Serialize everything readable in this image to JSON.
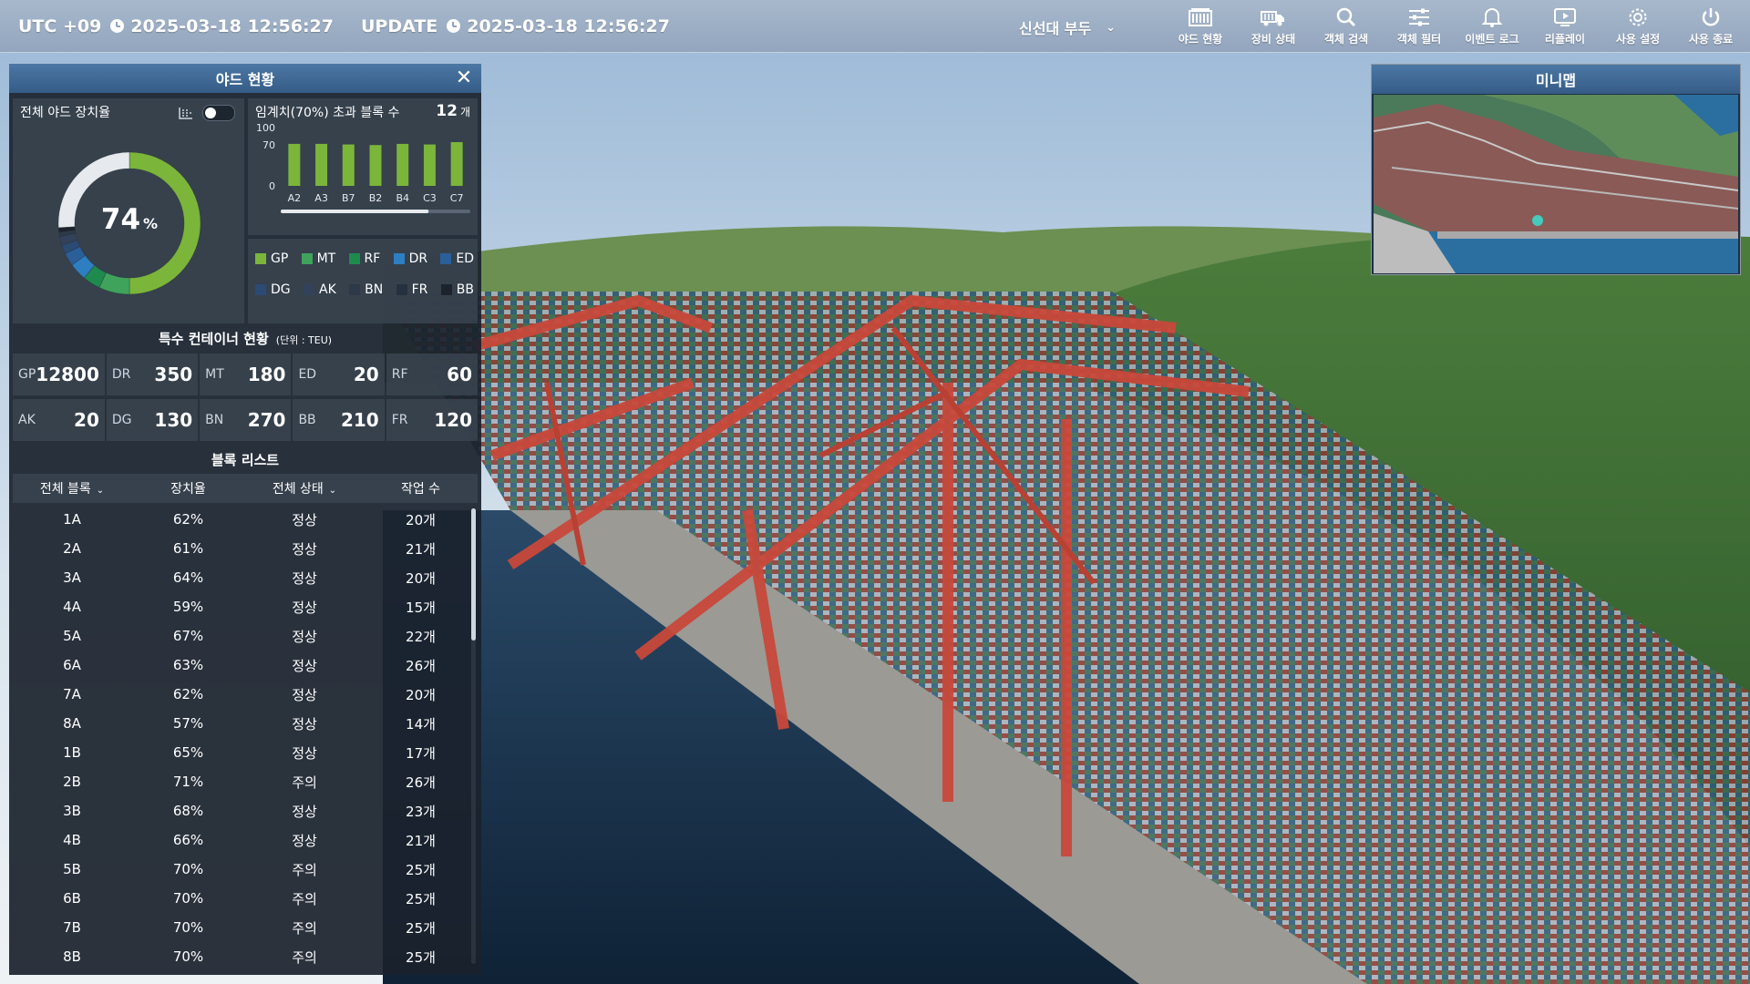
{
  "topbar": {
    "utc_label": "UTC +09",
    "utc_time": "2025-03-18 12:56:27",
    "update_label": "UPDATE",
    "update_time": "2025-03-18 12:56:27",
    "site": "신선대 부두",
    "menu": [
      {
        "label": "야드 현황",
        "icon": "yard-status-icon"
      },
      {
        "label": "장비 상태",
        "icon": "truck-icon"
      },
      {
        "label": "객체 검색",
        "icon": "search-icon"
      },
      {
        "label": "객체 필터",
        "icon": "filter-sliders-icon"
      },
      {
        "label": "이벤트 로그",
        "icon": "bell-icon"
      },
      {
        "label": "리플레이",
        "icon": "replay-icon"
      },
      {
        "label": "사용 설정",
        "icon": "gear-icon"
      },
      {
        "label": "사용 종료",
        "icon": "power-icon"
      }
    ]
  },
  "yard_panel": {
    "title": "야드 현황",
    "utilization_title": "전체 야드 장치율",
    "utilization_value": "74",
    "utilization_unit": "%",
    "threshold_title": "임계치(70%) 초과 블록 수",
    "threshold_count": "12",
    "threshold_unit": "개",
    "legend": [
      {
        "code": "GP",
        "color": "#7bb53a"
      },
      {
        "code": "MT",
        "color": "#3fa35c"
      },
      {
        "code": "RF",
        "color": "#1f8a4d"
      },
      {
        "code": "DR",
        "color": "#2d7fc1"
      },
      {
        "code": "ED",
        "color": "#2a5f9a"
      },
      {
        "code": "DG",
        "color": "#2b4a74"
      },
      {
        "code": "AK",
        "color": "#33425a"
      },
      {
        "code": "BN",
        "color": "#2d3848"
      },
      {
        "code": "FR",
        "color": "#263140"
      },
      {
        "code": "BB",
        "color": "#1c232d"
      }
    ],
    "special_title": "특수 컨테이너 현황",
    "special_unit": "(단위 : TEU)",
    "teu": [
      {
        "code": "GP",
        "value": "12800"
      },
      {
        "code": "DR",
        "value": "350"
      },
      {
        "code": "MT",
        "value": "180"
      },
      {
        "code": "ED",
        "value": "20"
      },
      {
        "code": "RF",
        "value": "60"
      },
      {
        "code": "AK",
        "value": "20"
      },
      {
        "code": "DG",
        "value": "130"
      },
      {
        "code": "BN",
        "value": "270"
      },
      {
        "code": "BB",
        "value": "210"
      },
      {
        "code": "FR",
        "value": "120"
      }
    ],
    "block_list_title": "블록 리스트",
    "columns": [
      "전체 블록",
      "장치율",
      "전체 상태",
      "작업 수"
    ],
    "rows": [
      [
        "1A",
        "62%",
        "정상",
        "20개"
      ],
      [
        "2A",
        "61%",
        "정상",
        "21개"
      ],
      [
        "3A",
        "64%",
        "정상",
        "20개"
      ],
      [
        "4A",
        "59%",
        "정상",
        "15개"
      ],
      [
        "5A",
        "67%",
        "정상",
        "22개"
      ],
      [
        "6A",
        "63%",
        "정상",
        "26개"
      ],
      [
        "7A",
        "62%",
        "정상",
        "20개"
      ],
      [
        "8A",
        "57%",
        "정상",
        "14개"
      ],
      [
        "1B",
        "65%",
        "정상",
        "17개"
      ],
      [
        "2B",
        "71%",
        "주의",
        "26개"
      ],
      [
        "3B",
        "68%",
        "정상",
        "23개"
      ],
      [
        "4B",
        "66%",
        "정상",
        "21개"
      ],
      [
        "5B",
        "70%",
        "주의",
        "25개"
      ],
      [
        "6B",
        "70%",
        "주의",
        "25개"
      ],
      [
        "7B",
        "70%",
        "주의",
        "25개"
      ],
      [
        "8B",
        "70%",
        "주의",
        "25개"
      ]
    ]
  },
  "chart_data": [
    {
      "type": "pie",
      "title": "전체 야드 장치율",
      "center_label": "74 %",
      "segments": [
        {
          "code": "GP",
          "value": 50,
          "color": "#7bb53a"
        },
        {
          "code": "MT",
          "value": 7,
          "color": "#3fa35c"
        },
        {
          "code": "RF",
          "value": 4,
          "color": "#1f8a4d"
        },
        {
          "code": "DR",
          "value": 4,
          "color": "#2d7fc1"
        },
        {
          "code": "ED",
          "value": 3,
          "color": "#2a5f9a"
        },
        {
          "code": "DG",
          "value": 2,
          "color": "#2b4a74"
        },
        {
          "code": "AK",
          "value": 2,
          "color": "#33425a"
        },
        {
          "code": "BN",
          "value": 1,
          "color": "#2d3848"
        },
        {
          "code": "BB",
          "value": 1,
          "color": "#1c232d"
        },
        {
          "code": "empty",
          "value": 26,
          "color": "#e6e9ee"
        }
      ]
    },
    {
      "type": "bar",
      "title": "임계치(70%) 초과 블록 수",
      "categories": [
        "A2",
        "A3",
        "B7",
        "B2",
        "B4",
        "C3",
        "C7"
      ],
      "values": [
        72,
        72,
        71,
        70,
        72,
        71,
        75
      ],
      "ylim": [
        0,
        100
      ],
      "yticks": [
        0,
        70,
        100
      ],
      "threshold": 70,
      "color": "#7bb53a"
    }
  ],
  "minimap": {
    "title": "미니맵"
  }
}
